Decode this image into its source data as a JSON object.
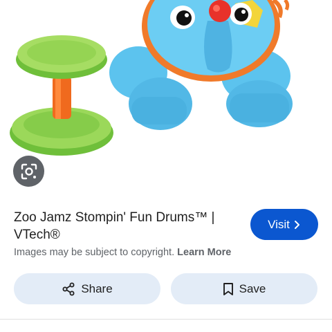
{
  "result": {
    "title": "Zoo Jamz Stompin' Fun Drums™ | VTech®",
    "visit_label": "Visit",
    "copyright_text": "Images may be subject to copyright.",
    "learn_more_label": "Learn More"
  },
  "actions": {
    "share_label": "Share",
    "save_label": "Save"
  },
  "icons": {
    "lens": "lens-search-icon",
    "visit": "chevron-right-icon",
    "share": "share-icon",
    "save": "bookmark-icon"
  },
  "colors": {
    "visit_button": "#0b57d0",
    "action_button": "#e3ecf7",
    "lens_button": "#5f6368"
  }
}
